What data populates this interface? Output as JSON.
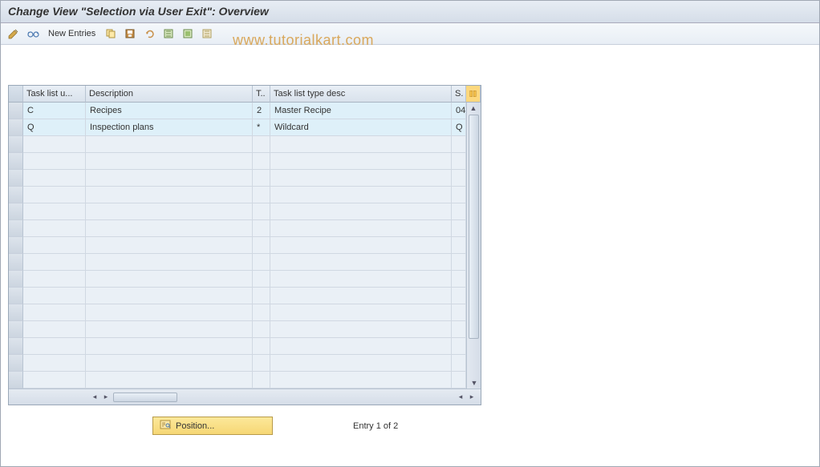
{
  "title": "Change View \"Selection via User Exit\": Overview",
  "toolbar": {
    "new_entries": "New Entries"
  },
  "watermark": "www.tutorialkart.com",
  "table": {
    "headers": {
      "col1": "Task list u...",
      "col2": "Description",
      "col3": "T..",
      "col4": "Task list type desc",
      "col5": "S."
    },
    "rows": [
      {
        "c1": "C",
        "c2": "Recipes",
        "c3": "2",
        "c4": "Master Recipe",
        "c5": "04"
      },
      {
        "c1": "Q",
        "c2": "Inspection plans",
        "c3": "*",
        "c4": "Wildcard",
        "c5": "Q"
      }
    ],
    "empty_rows": 15
  },
  "footer": {
    "position_label": "Position...",
    "entry_label": "Entry 1 of 2"
  }
}
